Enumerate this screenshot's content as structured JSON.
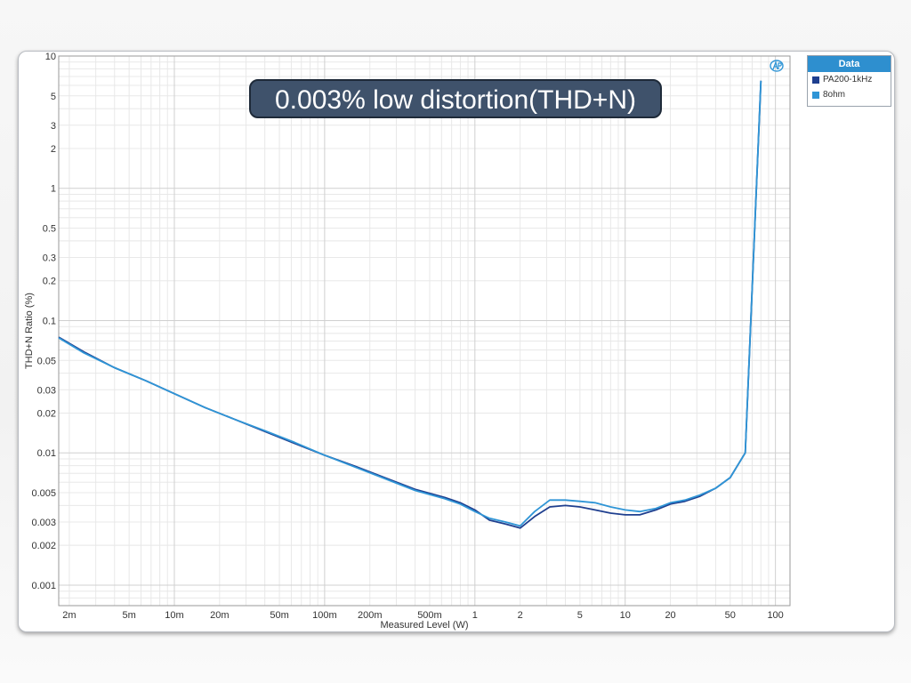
{
  "banner": {
    "text": "0.003% low distortion(THD+N)"
  },
  "legend": {
    "title": "Data",
    "items": [
      {
        "label": "PA200-1kHz",
        "color": "#1f3f8f"
      },
      {
        "label": "8ohm",
        "color": "#2f95d6"
      }
    ]
  },
  "logo": {
    "icon": "ap-logo-icon"
  },
  "chart_data": {
    "type": "line",
    "title": "",
    "xlabel": "Measured Level (W)",
    "ylabel": "THD+N Ratio (%)",
    "x_scale": "log",
    "y_scale": "log",
    "xlim": [
      0.0017,
      125
    ],
    "ylim": [
      0.0007,
      10
    ],
    "grid": true,
    "legend_position": "top-right",
    "x_ticks": [
      {
        "v": 0.002,
        "label": "2m"
      },
      {
        "v": 0.005,
        "label": "5m"
      },
      {
        "v": 0.01,
        "label": "10m"
      },
      {
        "v": 0.02,
        "label": "20m"
      },
      {
        "v": 0.05,
        "label": "50m"
      },
      {
        "v": 0.1,
        "label": "100m"
      },
      {
        "v": 0.2,
        "label": "200m"
      },
      {
        "v": 0.5,
        "label": "500m"
      },
      {
        "v": 1,
        "label": "1"
      },
      {
        "v": 2,
        "label": "2"
      },
      {
        "v": 5,
        "label": "5"
      },
      {
        "v": 10,
        "label": "10"
      },
      {
        "v": 20,
        "label": "20"
      },
      {
        "v": 50,
        "label": "50"
      },
      {
        "v": 100,
        "label": "100"
      }
    ],
    "y_ticks": [
      {
        "v": 10,
        "label": "10"
      },
      {
        "v": 5,
        "label": "5"
      },
      {
        "v": 3,
        "label": "3"
      },
      {
        "v": 2,
        "label": "2"
      },
      {
        "v": 1,
        "label": "1"
      },
      {
        "v": 0.5,
        "label": "0.5"
      },
      {
        "v": 0.3,
        "label": "0.3"
      },
      {
        "v": 0.2,
        "label": "0.2"
      },
      {
        "v": 0.1,
        "label": "0.1"
      },
      {
        "v": 0.05,
        "label": "0.05"
      },
      {
        "v": 0.03,
        "label": "0.03"
      },
      {
        "v": 0.02,
        "label": "0.02"
      },
      {
        "v": 0.01,
        "label": "0.01"
      },
      {
        "v": 0.005,
        "label": "0.005"
      },
      {
        "v": 0.003,
        "label": "0.003"
      },
      {
        "v": 0.002,
        "label": "0.002"
      },
      {
        "v": 0.001,
        "label": "0.001"
      }
    ],
    "series": [
      {
        "name": "PA200-1kHz",
        "color": "#1f3f8f",
        "x": [
          0.0017,
          0.0025,
          0.004,
          0.0065,
          0.01,
          0.016,
          0.025,
          0.04,
          0.063,
          0.1,
          0.16,
          0.25,
          0.4,
          0.63,
          0.8,
          1.0,
          1.25,
          1.6,
          2.0,
          2.5,
          3.15,
          4,
          5,
          6.3,
          8,
          10,
          12.5,
          16,
          20,
          25,
          31.5,
          40,
          50,
          63,
          80
        ],
        "y": [
          0.075,
          0.058,
          0.044,
          0.035,
          0.028,
          0.022,
          0.018,
          0.0145,
          0.0118,
          0.0096,
          0.0079,
          0.0065,
          0.0053,
          0.0046,
          0.0042,
          0.0037,
          0.0031,
          0.0029,
          0.0027,
          0.0033,
          0.0039,
          0.004,
          0.0039,
          0.0037,
          0.0035,
          0.0034,
          0.0034,
          0.0037,
          0.0041,
          0.0043,
          0.0047,
          0.0054,
          0.0065,
          0.01,
          6.5
        ]
      },
      {
        "name": "8ohm",
        "color": "#2f95d6",
        "x": [
          0.0017,
          0.0025,
          0.004,
          0.0065,
          0.01,
          0.016,
          0.025,
          0.04,
          0.063,
          0.1,
          0.16,
          0.25,
          0.4,
          0.63,
          0.8,
          1.0,
          1.25,
          1.6,
          2.0,
          2.5,
          3.15,
          4,
          5,
          6.3,
          8,
          10,
          12.5,
          16,
          20,
          25,
          31.5,
          40,
          50,
          63,
          80
        ],
        "y": [
          0.074,
          0.057,
          0.044,
          0.035,
          0.028,
          0.022,
          0.018,
          0.0147,
          0.012,
          0.0096,
          0.0078,
          0.0064,
          0.0052,
          0.0045,
          0.0041,
          0.0036,
          0.0032,
          0.003,
          0.0028,
          0.0036,
          0.0044,
          0.0044,
          0.0043,
          0.0042,
          0.0039,
          0.0037,
          0.0036,
          0.0038,
          0.0042,
          0.0044,
          0.0048,
          0.0054,
          0.0065,
          0.01,
          6.5
        ]
      }
    ]
  }
}
